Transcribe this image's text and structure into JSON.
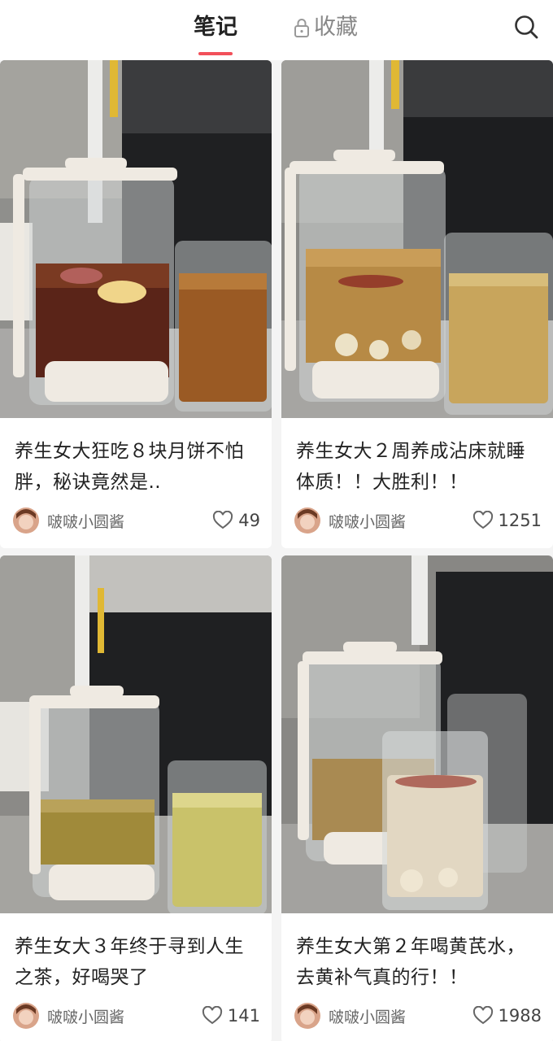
{
  "header": {
    "tab_notes": "笔记",
    "tab_favorites": "收藏",
    "accent_color": "#f2505a"
  },
  "notes": [
    {
      "title": "养生女大狂吃８块月饼不怕胖，秘诀竟然是..",
      "author": "啵啵小圆酱",
      "likes": "49"
    },
    {
      "title": "养生女大２周养成沾床就睡体质！！大胜利！！",
      "author": "啵啵小圆酱",
      "likes": "1251"
    },
    {
      "title": "养生女大３年终于寻到人生之茶，好喝哭了",
      "author": "啵啵小圆酱",
      "likes": "141"
    },
    {
      "title": "养生女大第２年喝黄芪水，去黄补气真的行！！",
      "author": "啵啵小圆酱",
      "likes": "1988"
    }
  ],
  "icons": {
    "lock": "lock-icon",
    "search": "search-icon",
    "heart": "heart-outline-icon"
  }
}
